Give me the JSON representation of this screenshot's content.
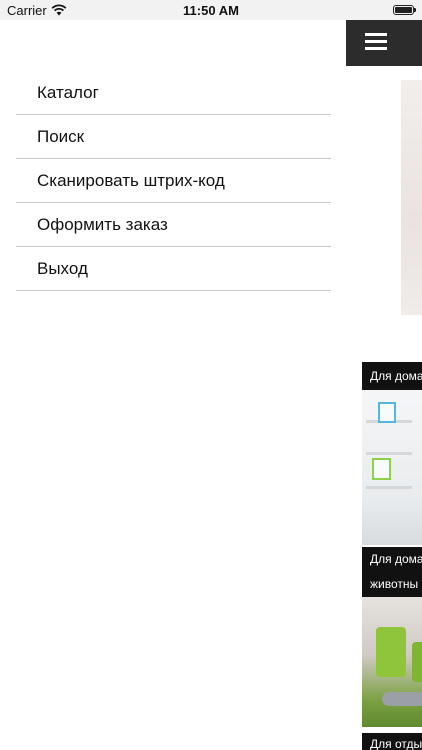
{
  "status_bar": {
    "carrier": "Carrier",
    "time": "11:50 AM"
  },
  "menu": {
    "items": [
      {
        "label": "Каталог"
      },
      {
        "label": "Поиск"
      },
      {
        "label": "Сканировать штрих-код"
      },
      {
        "label": "Оформить заказ"
      },
      {
        "label": "Выход"
      }
    ]
  },
  "content": {
    "cards": [
      {
        "label": "Для дома"
      },
      {
        "label": "Для дома",
        "label_line2": "животны"
      },
      {
        "label": "Для отды"
      }
    ]
  },
  "colors": {
    "navbar": "#2c2c2c",
    "card_label_bg": "#111111",
    "separator": "#c8c8c8"
  }
}
